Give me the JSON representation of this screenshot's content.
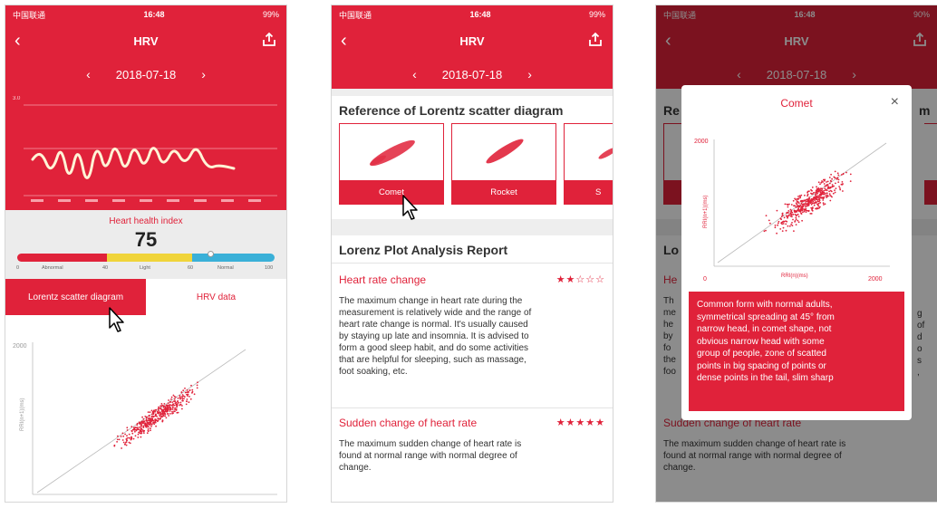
{
  "status": {
    "carrier": "中国联通",
    "time": "16:48",
    "battery": "99%"
  },
  "status3": {
    "battery": "90%"
  },
  "nav": {
    "title": "HRV",
    "back_glyph": "‹"
  },
  "date": {
    "value": "2018-07-18",
    "prev_glyph": "‹",
    "next_glyph": "›"
  },
  "screen1": {
    "chart_ymax": "3.0",
    "index_label": "Heart health index",
    "index_value": "75",
    "gauge_value": 75,
    "gauge_ticks": [
      "0",
      "Abnormal",
      "40",
      "Light",
      "60",
      "Normal",
      "100"
    ],
    "tabs": [
      "Lorentz scatter diagram",
      "HRV data"
    ],
    "scatter_axis": {
      "ymax": "2000",
      "ylabel": "RRI(n+1)(ms)"
    }
  },
  "screen2": {
    "ref_title": "Reference of Lorentz scatter diagram",
    "thumbs": [
      "Comet",
      "Rocket",
      "S"
    ],
    "report_title": "Lorenz Plot Analysis Report",
    "items": [
      {
        "name": "Heart rate change",
        "stars": "★★☆☆☆",
        "desc": [
          "The maximum change in heart rate during the",
          "measurement is relatively wide and the range of",
          "heart rate change is normal. It's usually caused",
          "by staying up late and insomnia. It is advised to",
          "form a good sleep habit, and do some activities",
          "that are helpful for sleeping, such as massage,",
          "foot soaking, etc."
        ]
      },
      {
        "name": "Sudden change of heart rate",
        "stars": "★★★★★",
        "desc": [
          "The maximum sudden change of heart rate is",
          "found at normal range with normal degree of",
          "change."
        ]
      }
    ]
  },
  "screen3": {
    "modal_title": "Comet",
    "close_glyph": "×",
    "axis": {
      "y_max": "2000",
      "x_min": "0",
      "x_max": "2000",
      "x_label": "RRI(n)(ms)",
      "y_label": "RRI(n+1)(ms)"
    },
    "description": [
      "Common form with normal adults,",
      "symmetrical spreading at 45° from",
      "narrow head, in comet shape, not",
      "obvious narrow head with some",
      "group of people, zone of scatted",
      "points in big spacing of points or",
      "dense points in the tail, slim sharp"
    ],
    "behind": {
      "ref_fragment_left": "Re",
      "ref_fragment_right": "m",
      "report_fragment": "Lo",
      "item_fragment": "He",
      "left_fragments": [
        "Th",
        "me",
        "he",
        "by",
        "fo",
        "the",
        "foo"
      ],
      "right_fragments": [
        "g",
        "of",
        "d",
        "o",
        "s",
        ","
      ],
      "sudden_title": "Sudden change of heart rate",
      "sudden_desc": [
        "The maximum sudden change of heart rate is",
        "found at normal range with normal degree of",
        "change."
      ]
    }
  },
  "colors": {
    "brand_red": "#e0223a",
    "gauge_yellow": "#f0d43a",
    "gauge_blue": "#3ab0d8"
  }
}
